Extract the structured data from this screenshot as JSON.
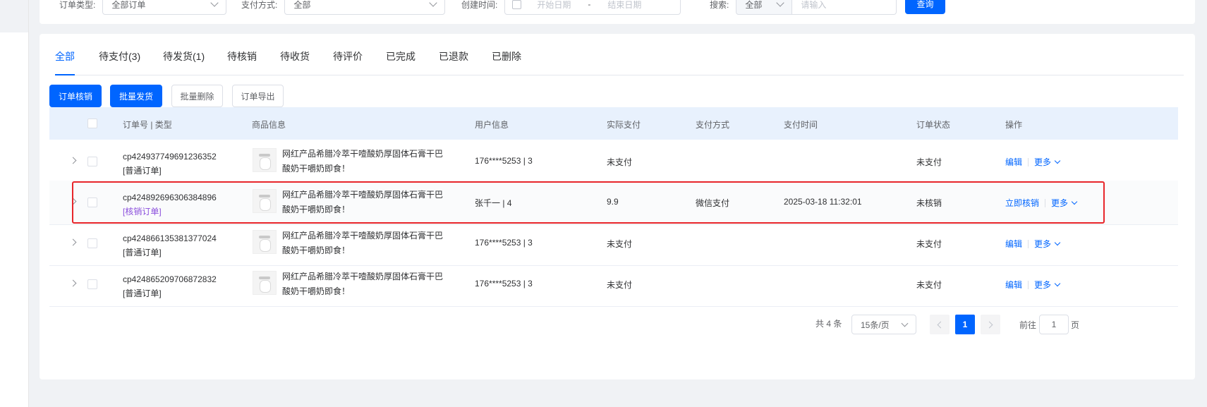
{
  "filters": {
    "order_type": {
      "label": "订单类型:",
      "value": "全部订单"
    },
    "pay_method": {
      "label": "支付方式:",
      "value": "全部"
    },
    "created": {
      "label": "创建时间:",
      "start_placeholder": "开始日期",
      "separator": "-",
      "end_placeholder": "结束日期"
    },
    "search": {
      "label": "搜索:",
      "scope": "全部",
      "placeholder": "请输入"
    },
    "query_button": "查询"
  },
  "tabs": [
    "全部",
    "待支付(3)",
    "待发货(1)",
    "待核销",
    "待收货",
    "待评价",
    "已完成",
    "已退款",
    "已删除"
  ],
  "actions": {
    "verify": "订单核销",
    "batch_ship": "批量发货",
    "batch_delete": "批量删除",
    "export": "订单导出"
  },
  "table": {
    "headers": {
      "order": "订单号 | 类型",
      "goods": "商品信息",
      "user": "用户信息",
      "paid": "实际支付",
      "method": "支付方式",
      "time": "支付时间",
      "status": "订单状态",
      "ops": "操作"
    },
    "rows": [
      {
        "order_no": "cp424937749691236352",
        "type": "[普通订单]",
        "goods": "网红产品希腊冷萃干噎酸奶厚固体石膏干巴酸奶干嚼奶即食！",
        "user": "176****5253 | 3",
        "paid": "未支付",
        "method": "",
        "time": "",
        "status": "未支付",
        "op1": "编辑",
        "op2": "更多"
      },
      {
        "order_no": "cp424892696306384896",
        "type": "[核销订单]",
        "goods": "网红产品希腊冷萃干噎酸奶厚固体石膏干巴酸奶干嚼奶即食！",
        "user": "张千一 | 4",
        "paid": "9.9",
        "method": "微信支付",
        "time": "2025-03-18 11:32:01",
        "status": "未核销",
        "op1": "立即核销",
        "op2": "更多"
      },
      {
        "order_no": "cp424866135381377024",
        "type": "[普通订单]",
        "goods": "网红产品希腊冷萃干噎酸奶厚固体石膏干巴酸奶干嚼奶即食！",
        "user": "176****5253 | 3",
        "paid": "未支付",
        "method": "",
        "time": "",
        "status": "未支付",
        "op1": "编辑",
        "op2": "更多"
      },
      {
        "order_no": "cp424865209706872832",
        "type": "[普通订单]",
        "goods": "网红产品希腊冷萃干噎酸奶厚固体石膏干巴酸奶干嚼奶即食！",
        "user": "176****5253 | 3",
        "paid": "未支付",
        "method": "",
        "time": "",
        "status": "未支付",
        "op1": "编辑",
        "op2": "更多"
      }
    ]
  },
  "pagination": {
    "total": "共 4 条",
    "page_size": "15条/页",
    "current": "1",
    "goto_label": "前往",
    "goto_value": "1",
    "page_suffix": "页"
  },
  "colors": {
    "primary": "#0065ff",
    "highlight_border": "#e8262b",
    "verify_type": "#8b4fdc"
  }
}
